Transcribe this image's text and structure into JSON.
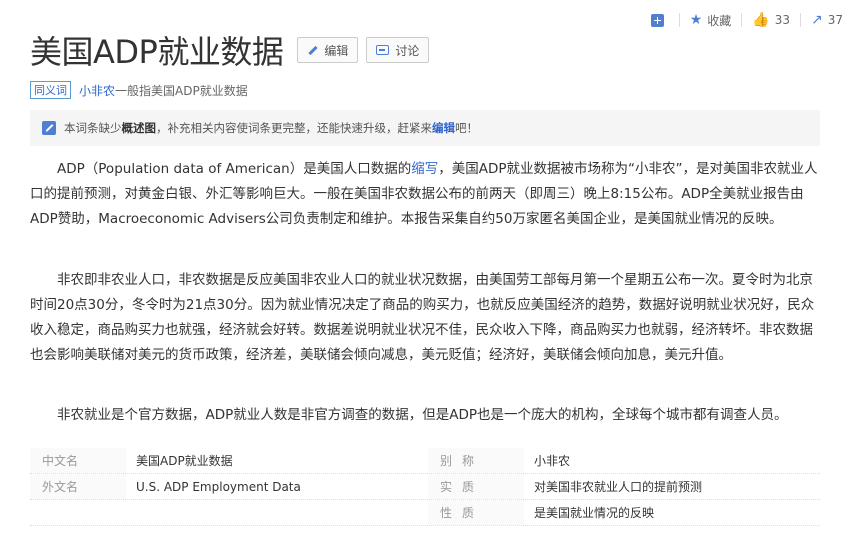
{
  "actions": {
    "add_icon": "plus-square-icon",
    "favorite_label": "收藏",
    "favorite_icon": "star-icon",
    "like_count": "33",
    "like_icon": "thumbs-up-icon",
    "share_count": "37",
    "share_icon": "share-icon"
  },
  "header": {
    "title": "美国ADP就业数据",
    "edit_label": "编辑",
    "discuss_label": "讨论"
  },
  "synonym": {
    "tag": "同义词",
    "link": "小非农",
    "text": "一般指美国ADP就业数据"
  },
  "notice": {
    "prefix": "本词条缺少",
    "bold": "概述图",
    "middle": "，补充相关内容使词条更完整，还能快速升级，赶紧来",
    "link": "编辑",
    "suffix": "吧！"
  },
  "paragraphs": {
    "p1_a": "ADP（Population data of American）是美国人口数据的",
    "p1_link": "缩写",
    "p1_b": "，美国ADP就业数据被市场称为“小非农”，是对美国非农就业人口的提前预测，对黄金白银、外汇等影响巨大。一般在美国非农数据公布的前两天（即周三）晚上8:15公布。ADP全美就业报告由ADP赞助，Macroeconomic Advisers公司负责制定和维护。本报告采集自约50万家匿名美国企业，是美国就业情况的反映。",
    "p2": "非农即非农业人口，非农数据是反应美国非农业人口的就业状况数据，由美国劳工部每月第一个星期五公布一次。夏令时为北京时间20点30分，冬令时为21点30分。因为就业情况决定了商品的购买力，也就反应美国经济的趋势，数据好说明就业状况好，民众收入稳定，商品购买力也就强，经济就会好转。数据差说明就业状况不佳，民众收入下降，商品购买力也就弱，经济转坏。非农数据也会影响美联储对美元的货币政策，经济差，美联储会倾向减息，美元贬值；经济好，美联储会倾向加息，美元升值。",
    "p3": "非农就业是个官方数据，ADP就业人数是非官方调查的数据，但是ADP也是一个庞大的机构，全球每个城市都有调查人员。"
  },
  "info": {
    "rows": [
      {
        "k1": "中文名",
        "v1": "美国ADP就业数据",
        "k2": "别称",
        "v2": "小非农"
      },
      {
        "k1": "外文名",
        "v1": "U.S. ADP Employment Data",
        "k2": "实质",
        "v2": "对美国非农就业人口的提前预测"
      },
      {
        "k1": "",
        "v1": "",
        "k2": "性质",
        "v2": "是美国就业情况的反映"
      }
    ]
  }
}
